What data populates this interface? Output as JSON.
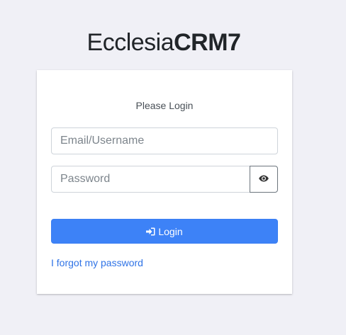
{
  "brand": {
    "name_light": "Ecclesia",
    "name_bold": "CRM7"
  },
  "login_box": {
    "title": "Please Login",
    "email_placeholder": "Email/Username",
    "password_placeholder": "Password",
    "toggle_password_icon": "eye-icon",
    "login_button_label": "Login",
    "login_button_icon": "sign-in-icon",
    "forgot_password_link": "I forgot my password"
  },
  "colors": {
    "background": "#f0f0f6",
    "primary_button": "#3d82f7",
    "link": "#2f73e6"
  }
}
